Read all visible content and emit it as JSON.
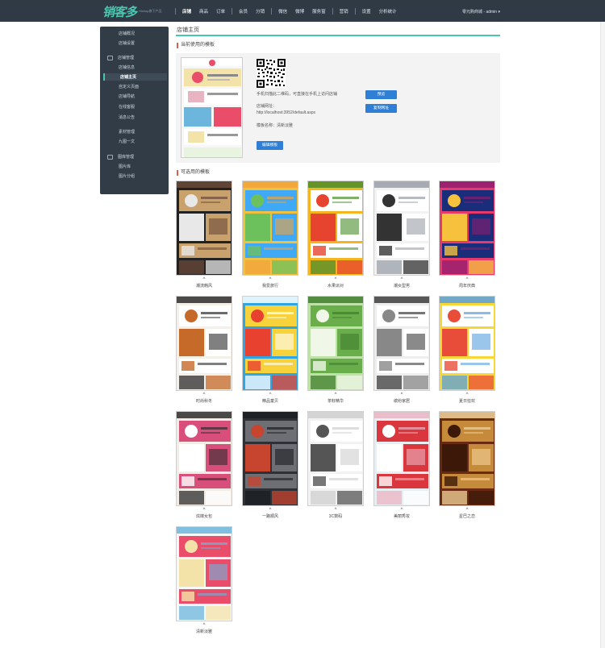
{
  "app": {
    "logo_text": "销客多",
    "logo_sub": "Hishop旗下产品",
    "user": "零元购商城 - admin"
  },
  "nav": [
    "店铺",
    "商品",
    "订单",
    "会员",
    "分销",
    "微信",
    "微博",
    "服务窗",
    "营销",
    "设置",
    "分析统计"
  ],
  "sidebar": {
    "group1_items": [
      "店铺概况",
      "店铺设置"
    ],
    "group2_title": "店铺管理",
    "group2_items": [
      "店铺信息",
      "店铺主页",
      "自定义页面",
      "店铺导航",
      "在线客服",
      "消息公告",
      "素材管理",
      "九图一文"
    ],
    "group3_title": "图库管理",
    "group3_items": [
      "图片库",
      "图片分组"
    ]
  },
  "page": {
    "title": "店铺主页",
    "current_label": "当前使用的模板",
    "scan_hint": "手机扫描此二维码，可直接在手机上访问店铺",
    "url_label": "店铺网址：",
    "url_value": "http://localhost:3952/default.aspx",
    "template_name": "模板名称：清新淡雅",
    "preview_btn": "预览",
    "copy_btn": "复制网址",
    "edit_btn": "编辑模板",
    "available_label": "可选用的模板"
  },
  "templates": [
    {
      "name": "潮流韩风",
      "colors": [
        "#222222",
        "#c9a16c",
        "#e8e8e8",
        "#6b4a3a"
      ]
    },
    {
      "name": "我爱旅行",
      "colors": [
        "#f0c040",
        "#3fa9f5",
        "#6dc15c",
        "#f3a33b"
      ]
    },
    {
      "name": "水果派对",
      "colors": [
        "#f4b520",
        "#ffffff",
        "#e6442f",
        "#4a8d2a"
      ]
    },
    {
      "name": "潮女型男",
      "colors": [
        "#f2f2f2",
        "#ffffff",
        "#333333",
        "#9aa0a8"
      ]
    },
    {
      "name": "周年庆典",
      "colors": [
        "#e8396b",
        "#1a2d7a",
        "#f6c23d",
        "#8f1d6e"
      ]
    },
    {
      "name": "时尚秋冬",
      "colors": [
        "#f4f0e8",
        "#ffffff",
        "#c66a2a",
        "#2c2c2c"
      ]
    },
    {
      "name": "精品童贝",
      "colors": [
        "#2fa5e4",
        "#f7d23a",
        "#e8412f",
        "#ffffff"
      ]
    },
    {
      "name": "茶籽精华",
      "colors": [
        "#bde2a5",
        "#6aae4c",
        "#f0f7e8",
        "#3f7c2c"
      ]
    },
    {
      "name": "缤纷家居",
      "colors": [
        "#eeeeee",
        "#ffffff",
        "#888888",
        "#3c3c3c"
      ]
    },
    {
      "name": "夏日狂欢",
      "colors": [
        "#f7d637",
        "#ffffff",
        "#e84d3a",
        "#59a0e0"
      ]
    },
    {
      "name": "炫媒女包",
      "colors": [
        "#f3ece4",
        "#d94f7c",
        "#ffffff",
        "#2d2d2d"
      ]
    },
    {
      "name": "一路顺风",
      "colors": [
        "#2d3036",
        "#6d6f75",
        "#c7442f",
        "#1b1d22"
      ]
    },
    {
      "name": "3C数码",
      "colors": [
        "#f2f2f2",
        "#ffffff",
        "#555555",
        "#cfcfcf"
      ]
    },
    {
      "name": "美丽秀妆",
      "colors": [
        "#e9eef2",
        "#d9363e",
        "#ffffff",
        "#e9b4c2"
      ]
    },
    {
      "name": "星巴之恋",
      "colors": [
        "#6a2a12",
        "#c58b3a",
        "#3b1808",
        "#f3d49c"
      ]
    },
    {
      "name": "清新淡雅",
      "colors": [
        "#f7f7f7",
        "#e94d6a",
        "#f4e3a8",
        "#6cb5dd"
      ]
    }
  ]
}
